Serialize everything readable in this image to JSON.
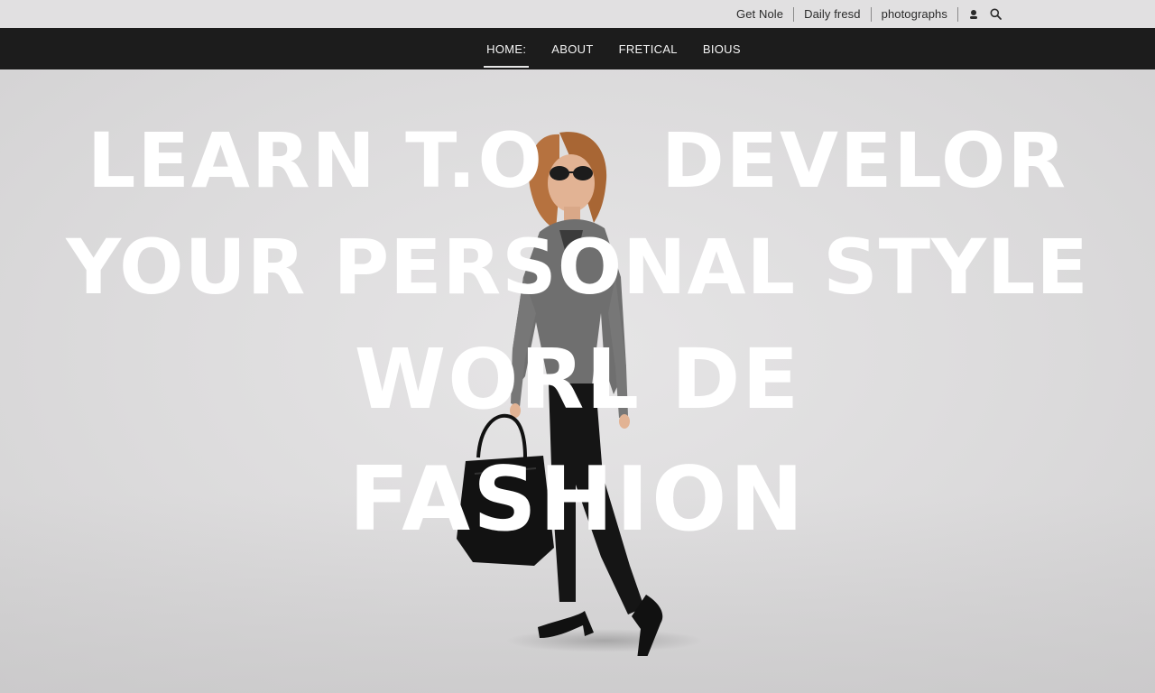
{
  "utility_bar": {
    "links": [
      "Get Nole",
      "Daily fresd",
      "photographs"
    ],
    "icons": [
      "sunglasses-icon",
      "search-icon"
    ]
  },
  "nav": {
    "items": [
      {
        "label": "HOME:",
        "active": true
      },
      {
        "label": "ABOUT",
        "active": false
      },
      {
        "label": "FRETICAL",
        "active": false
      },
      {
        "label": "BIOUS",
        "active": false
      }
    ]
  },
  "hero": {
    "line1_left": "LEARN T.O",
    "line1_right": "DEVELOR",
    "line2": "YOUR PERSONAL STYLE",
    "line3": "WORL DE",
    "line4": "FASHION"
  },
  "colors": {
    "utility_bg": "#e1e0e1",
    "nav_bg": "#1c1c1c",
    "hero_bg": "#dcdbdc",
    "hero_text": "#ffffff"
  }
}
